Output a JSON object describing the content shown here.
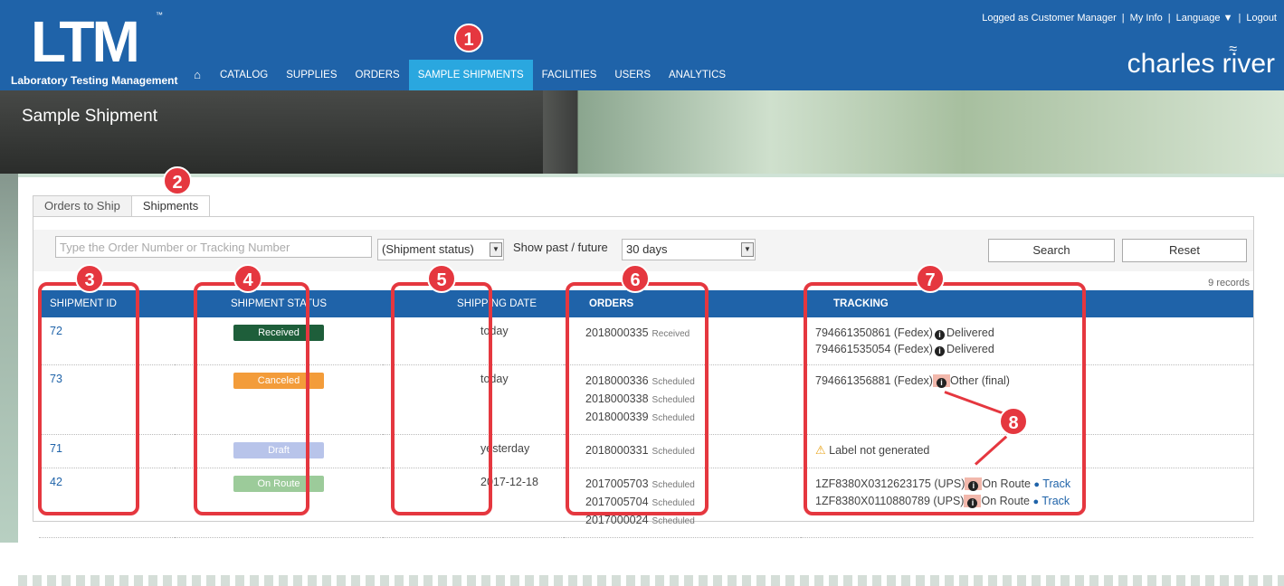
{
  "app": {
    "logo_text": "LTM",
    "logo_tm": "™",
    "logo_subtitle": "Laboratory Testing Management",
    "brand": "charles river"
  },
  "nav": {
    "home_icon": "home-icon",
    "items": [
      "CATALOG",
      "SUPPLIES",
      "ORDERS",
      "SAMPLE SHIPMENTS",
      "FACILITIES",
      "USERS",
      "ANALYTICS"
    ],
    "active": "SAMPLE SHIPMENTS"
  },
  "topright": {
    "logged": "Logged as Customer Manager",
    "sep": "|",
    "myinfo": "My Info",
    "language": "Language ▼",
    "logout": "Logout"
  },
  "page": {
    "title": "Sample Shipment"
  },
  "tabs": [
    "Orders to Ship",
    "Shipments"
  ],
  "filters": {
    "search_placeholder": "Type the Order Number or Tracking Number",
    "status_value": "(Shipment status)",
    "range_label": "Show past / future",
    "range_value": "30 days",
    "search_btn": "Search",
    "reset_btn": "Reset",
    "records": "9 records"
  },
  "table": {
    "headers": [
      "SHIPMENT ID",
      "SHIPMENT STATUS",
      "SHIPPING DATE",
      "ORDERS",
      "TRACKING"
    ],
    "rows": [
      {
        "id": "72",
        "status": "Received",
        "status_color": "#1e5e3a",
        "date": "today",
        "orders": [
          {
            "num": "2018000335",
            "st": "Received"
          }
        ],
        "tracking": [
          {
            "num": "794661350861 (Fedex)",
            "state": "Delivered",
            "track": ""
          },
          {
            "num": "794661535054 (Fedex)",
            "state": "Delivered",
            "track": ""
          }
        ]
      },
      {
        "id": "73",
        "status": "Canceled",
        "status_color": "#f39c3a",
        "date": "today",
        "orders": [
          {
            "num": "2018000336",
            "st": "Scheduled"
          },
          {
            "num": "2018000338",
            "st": "Scheduled"
          },
          {
            "num": "2018000339",
            "st": "Scheduled"
          }
        ],
        "tracking": [
          {
            "num": "794661356881 (Fedex)",
            "state": "Other (final)",
            "track": ""
          }
        ]
      },
      {
        "id": "71",
        "status": "Draft",
        "status_color": "#b8c4ea",
        "date": "yesterday",
        "orders": [
          {
            "num": "2018000331",
            "st": "Scheduled"
          }
        ],
        "warning": "Label not generated"
      },
      {
        "id": "42",
        "status": "On Route",
        "status_color": "#9ccb9a",
        "date": "2017-12-18",
        "orders": [
          {
            "num": "2017005703",
            "st": "Scheduled"
          },
          {
            "num": "2017005704",
            "st": "Scheduled"
          },
          {
            "num": "2017000024",
            "st": "Scheduled"
          }
        ],
        "tracking": [
          {
            "num": "1ZF8380X0312623175 (UPS)",
            "state": "On Route",
            "track": "Track"
          },
          {
            "num": "1ZF8380X0110880789 (UPS)",
            "state": "On Route",
            "track": "Track"
          }
        ]
      }
    ]
  },
  "annotations": [
    "1",
    "2",
    "3",
    "4",
    "5",
    "6",
    "7",
    "8"
  ],
  "colors": {
    "primary": "#1f63a9",
    "active_nav": "#2aa7df",
    "annotation": "#e5373f"
  }
}
